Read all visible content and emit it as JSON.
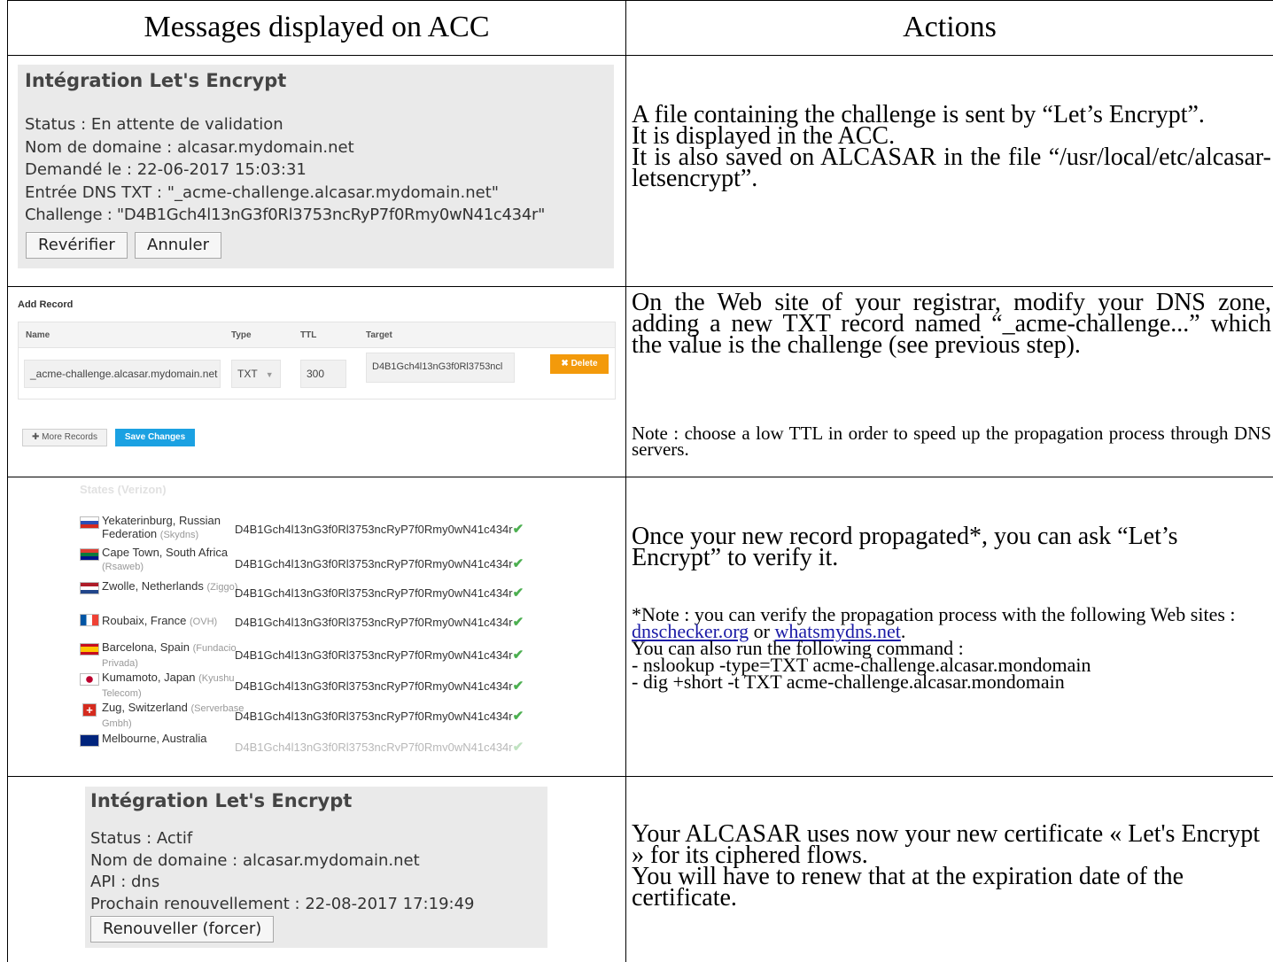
{
  "header": {
    "col1": "Messages displayed on ACC",
    "col2": "Actions"
  },
  "row1": {
    "panel": {
      "title": "Intégration Let's Encrypt",
      "lines": [
        "Status : En attente de validation",
        "Nom de domaine : alcasar.mydomain.net",
        "Demandé le : 22-06-2017 15:03:31",
        "Entrée DNS TXT : \"_acme-challenge.alcasar.mydomain.net\"",
        "Challenge : \"D4B1Gch4l13nG3f0Rl3753ncRyP7f0Rmy0wN41c434r\""
      ],
      "btn_recheck": "Revérifier",
      "btn_cancel": "Annuler"
    },
    "action": {
      "p1": "A file containing the challenge is sent by “Let’s Encrypt”.",
      "p2": "It is displayed in the ACC.",
      "p3": "It is also saved on ALCASAR in the file “/usr/local/etc/alcasar-letsencrypt”."
    }
  },
  "row2": {
    "form": {
      "title": "Add Record",
      "col_name": "Name",
      "col_type": "Type",
      "col_ttl": "TTL",
      "col_target": "Target",
      "name_value": "_acme-challenge.alcasar.mydomain.net",
      "type_value": "TXT",
      "ttl_value": "300",
      "target_value": "D4B1Gch4l13nG3f0Rl3753ncl",
      "delete_label": "✖ Delete",
      "more_label": "✚ More Records",
      "save_label": "Save Changes"
    },
    "action": {
      "p1": "On the Web site of your registrar, modify your DNS zone, adding a new TXT record named “_acme-challenge...” which the value is the challenge (see previous step).",
      "note": "Note : choose a low TTL in order to speed up the propagation process through DNS servers."
    }
  },
  "row3": {
    "top_partial": "States (Verizon)",
    "value": "D4B1Gch4l13nG3f0Rl3753ncRyP7f0Rmy0wN41c434r",
    "servers": [
      {
        "city": "Yekaterinburg, Russian Federation",
        "isp": "(Skydns)"
      },
      {
        "city": "Cape Town, South Africa",
        "isp": "(Rsaweb)"
      },
      {
        "city": "Zwolle, Netherlands",
        "isp": "(Ziggo)"
      },
      {
        "city": "Roubaix, France",
        "isp": "(OVH)"
      },
      {
        "city": "Barcelona, Spain",
        "isp": "(Fundacio Privada)"
      },
      {
        "city": "Kumamoto, Japan",
        "isp": "(Kyushu Telecom)"
      },
      {
        "city": "Zug, Switzerland",
        "isp": "(Serverbase Gmbh)"
      },
      {
        "city": "Melbourne, Australia",
        "isp": ""
      }
    ],
    "action": {
      "p1": "Once your new record propagated*, you can ask “Let’s Encrypt” to verify it.",
      "note1": "*Note : you can verify the propagation process with the following Web sites :",
      "link1": "dnschecker.org",
      "or": "or",
      "link2": "whatsmydns.net",
      "note2": "You can also run the following command :",
      "cmd1": "- nslookup -type=TXT acme-challenge.alcasar.mondomain",
      "cmd2": "- dig +short -t TXT acme-challenge.alcasar.mondomain"
    }
  },
  "row4": {
    "panel": {
      "title": "Intégration Let's Encrypt",
      "lines": [
        "Status : Actif",
        "Nom de domaine : alcasar.mydomain.net",
        "API : dns",
        "Prochain renouvellement : 22-08-2017 17:19:49"
      ],
      "btn_renew": "Renouveller (forcer)"
    },
    "action": {
      "p1": "Your ALCASAR uses now your new certificate « Let's Encrypt » for its ciphered flows.",
      "p2": "You will have to renew that at the expiration date of the certificate."
    }
  },
  "colors": {
    "panel_bg": "#eaeaea",
    "delete_orange": "#f39a0b",
    "save_blue": "#1ba1e2",
    "check_green": "#4caf50",
    "link_blue": "#1a1aa6"
  }
}
